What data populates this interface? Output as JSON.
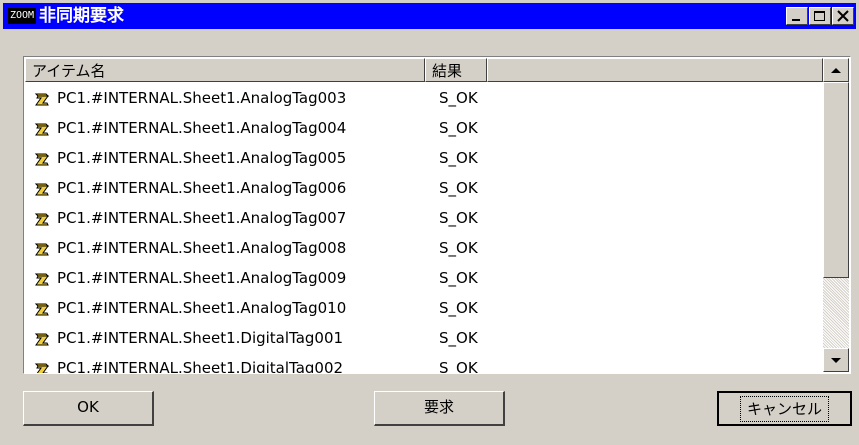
{
  "window": {
    "title": "非同期要求",
    "icon_label": "ZOOM",
    "controls": [
      "minimize-icon",
      "maximize-icon",
      "close-icon"
    ]
  },
  "list": {
    "columns": [
      "アイテム名",
      "結果"
    ],
    "rows": [
      {
        "name": "PC1.#INTERNAL.Sheet1.AnalogTag003",
        "result": "S_OK"
      },
      {
        "name": "PC1.#INTERNAL.Sheet1.AnalogTag004",
        "result": "S_OK"
      },
      {
        "name": "PC1.#INTERNAL.Sheet1.AnalogTag005",
        "result": "S_OK"
      },
      {
        "name": "PC1.#INTERNAL.Sheet1.AnalogTag006",
        "result": "S_OK"
      },
      {
        "name": "PC1.#INTERNAL.Sheet1.AnalogTag007",
        "result": "S_OK"
      },
      {
        "name": "PC1.#INTERNAL.Sheet1.AnalogTag008",
        "result": "S_OK"
      },
      {
        "name": "PC1.#INTERNAL.Sheet1.AnalogTag009",
        "result": "S_OK"
      },
      {
        "name": "PC1.#INTERNAL.Sheet1.AnalogTag010",
        "result": "S_OK"
      },
      {
        "name": "PC1.#INTERNAL.Sheet1.DigitalTag001",
        "result": "S_OK"
      },
      {
        "name": "PC1.#INTERNAL.Sheet1.DigitalTag002",
        "result": "S_OK"
      }
    ],
    "row_icon": "tag-icon"
  },
  "buttons": {
    "ok": "OK",
    "request": "要求",
    "cancel": "キャンセル"
  },
  "colors": {
    "titlebar": "#0000ff",
    "face": "#d4d0c8",
    "list_background": "#ffffff"
  }
}
